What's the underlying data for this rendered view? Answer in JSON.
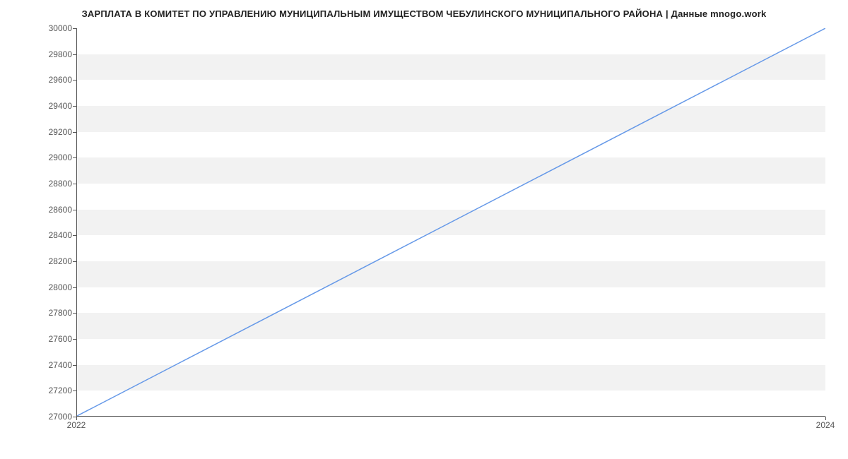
{
  "chart_data": {
    "type": "line",
    "title": "ЗАРПЛАТА В КОМИТЕТ ПО УПРАВЛЕНИЮ МУНИЦИПАЛЬНЫМ ИМУЩЕСТВОМ ЧЕБУЛИНСКОГО МУНИЦИПАЛЬНОГО РАЙОНА | Данные mnogo.work",
    "xlabel": "",
    "ylabel": "",
    "x": [
      2022,
      2024
    ],
    "values": [
      27000,
      30000
    ],
    "x_ticks": [
      2022,
      2024
    ],
    "y_ticks": [
      27000,
      27200,
      27400,
      27600,
      27800,
      28000,
      28200,
      28400,
      28600,
      28800,
      29000,
      29200,
      29400,
      29600,
      29800,
      30000
    ],
    "xlim": [
      2022,
      2024
    ],
    "ylim": [
      27000,
      30000
    ],
    "line_color": "#6699e8"
  }
}
